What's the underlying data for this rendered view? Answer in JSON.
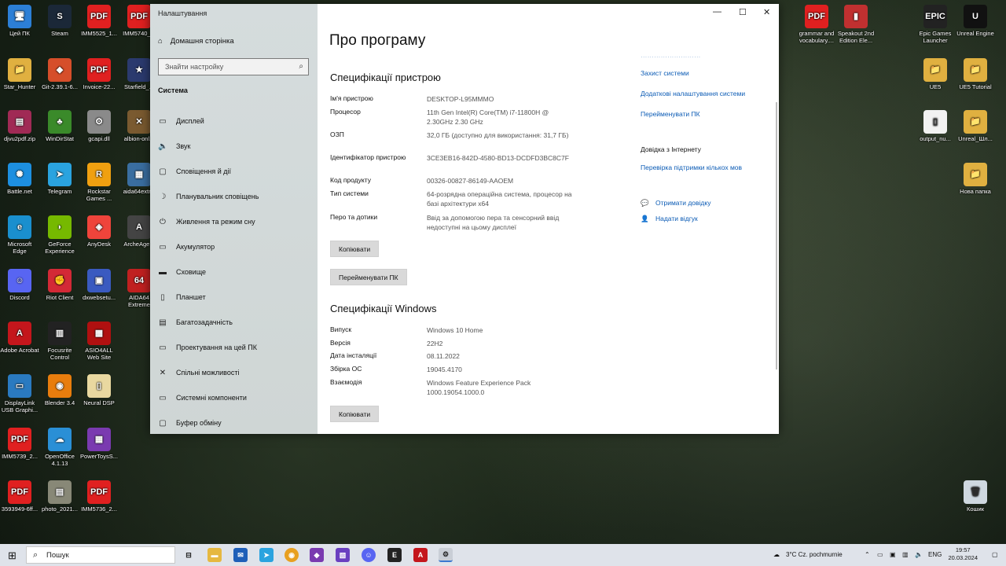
{
  "desktop": {
    "icons": [
      {
        "label": "Цей ПК",
        "glyph": "🖥",
        "color": "#2c7fd6"
      },
      {
        "label": "Steam",
        "glyph": "S",
        "color": "#1b2838"
      },
      {
        "label": "IMM5525_1...",
        "glyph": "PDF",
        "color": "#e02020"
      },
      {
        "label": "IMM5740_...",
        "glyph": "PDF",
        "color": "#e02020"
      },
      {
        "label": "Star_Hunter",
        "glyph": "📁",
        "color": "#e0b040"
      },
      {
        "label": "Git-2.39.1-6...",
        "glyph": "◆",
        "color": "#d64e2a"
      },
      {
        "label": "Invoice-22...",
        "glyph": "PDF",
        "color": "#e02020"
      },
      {
        "label": "Starfield_...",
        "glyph": "★",
        "color": "#2b3a6e"
      },
      {
        "label": "djvu2pdf.zip",
        "glyph": "▤",
        "color": "#a02a55"
      },
      {
        "label": "WinDirStat",
        "glyph": "♣",
        "color": "#3a8a2a"
      },
      {
        "label": "gcapi.dll",
        "glyph": "⚙",
        "color": "#8a8a8a"
      },
      {
        "label": "albion-onl...",
        "glyph": "✕",
        "color": "#7a5a30"
      },
      {
        "label": "Battle.net",
        "glyph": "✺",
        "color": "#1d8fe0"
      },
      {
        "label": "Telegram",
        "glyph": "➤",
        "color": "#2aa3df"
      },
      {
        "label": "Rockstar Games ...",
        "glyph": "R",
        "color": "#f0a010"
      },
      {
        "label": "aida64extr...",
        "glyph": "▦",
        "color": "#3a6ea0"
      },
      {
        "label": "Microsoft Edge",
        "glyph": "e",
        "color": "#1a8fce"
      },
      {
        "label": "GeForce Experience",
        "glyph": "◗",
        "color": "#76b900"
      },
      {
        "label": "AnyDesk",
        "glyph": "◈",
        "color": "#ef443b"
      },
      {
        "label": "ArcheAge...",
        "glyph": "A",
        "color": "#444444"
      },
      {
        "label": "Discord",
        "glyph": "☺",
        "color": "#5865f2"
      },
      {
        "label": "Riot Client",
        "glyph": "✊",
        "color": "#d32936"
      },
      {
        "label": "dxwebsetu...",
        "glyph": "▣",
        "color": "#3a5ac0"
      },
      {
        "label": "AIDA64 Extreme",
        "glyph": "64",
        "color": "#c02020"
      },
      {
        "label": "Adobe Acrobat",
        "glyph": "A",
        "color": "#c4161c"
      },
      {
        "label": "Focusrite Control",
        "glyph": "▥",
        "color": "#222222"
      },
      {
        "label": "ASIO4ALL Web Site",
        "glyph": "▩",
        "color": "#b01010"
      },
      {
        "label": "",
        "glyph": "",
        "color": "transparent"
      },
      {
        "label": "DisplayLink USB Graphi...",
        "glyph": "▭",
        "color": "#2a7ac0"
      },
      {
        "label": "Blender 3.4",
        "glyph": "◉",
        "color": "#e87d0d"
      },
      {
        "label": "Neural DSP",
        "glyph": "▯",
        "color": "#e9d8a0"
      },
      {
        "label": "",
        "glyph": "",
        "color": "transparent"
      },
      {
        "label": "IMM5739_2...",
        "glyph": "PDF",
        "color": "#e02020"
      },
      {
        "label": "OpenOffice 4.1.13",
        "glyph": "☁",
        "color": "#2a8fd6"
      },
      {
        "label": "PowerToysS...",
        "glyph": "▦",
        "color": "#7a3ab0"
      },
      {
        "label": "",
        "glyph": "",
        "color": "transparent"
      },
      {
        "label": "3593949-6ff...",
        "glyph": "PDF",
        "color": "#e02020"
      },
      {
        "label": "photo_2021...",
        "glyph": "▤",
        "color": "#888877"
      },
      {
        "label": "IMM5736_2...",
        "glyph": "PDF",
        "color": "#e02020"
      }
    ],
    "right_icons": [
      {
        "label": "grammar and vocabulary....",
        "glyph": "PDF",
        "color": "#e02020"
      },
      {
        "label": "Speakout 2nd Edition Ele...",
        "glyph": "▮",
        "color": "#c03030"
      },
      {
        "label": "Epic Games Launcher",
        "glyph": "EPIC",
        "color": "#222222"
      },
      {
        "label": "Unreal Engine",
        "glyph": "U",
        "color": "#111111"
      },
      {
        "label": "UE5",
        "glyph": "📁",
        "color": "#e0b040"
      },
      {
        "label": "UE5 Tutorial",
        "glyph": "📁",
        "color": "#e0b040"
      },
      {
        "label": "output_nu...",
        "glyph": "▯",
        "color": "#f2f2f2"
      },
      {
        "label": "Unreal_Шл...",
        "glyph": "📁",
        "color": "#e0b040"
      },
      {
        "label": "Нова папка",
        "glyph": "📁",
        "color": "#e0b040"
      },
      {
        "label": "Кошик",
        "glyph": "🗑",
        "color": "#cfd8e0"
      }
    ]
  },
  "window": {
    "title": "Налаштування",
    "home": "Домашня сторінка",
    "search_placeholder": "Знайти настройку",
    "section": "Система",
    "nav_items": [
      {
        "label": "Дисплей",
        "icon": "▭"
      },
      {
        "label": "Звук",
        "icon": "🔈"
      },
      {
        "label": "Сповіщення й дії",
        "icon": "▢"
      },
      {
        "label": "Планувальник сповіщень",
        "icon": "☽"
      },
      {
        "label": "Живлення та режим сну",
        "icon": "⏻"
      },
      {
        "label": "Акумулятор",
        "icon": "▭"
      },
      {
        "label": "Сховище",
        "icon": "▬"
      },
      {
        "label": "Планшет",
        "icon": "▯"
      },
      {
        "label": "Багатозадачність",
        "icon": "▤"
      },
      {
        "label": "Проектування на цей ПК",
        "icon": "▭"
      },
      {
        "label": "Спільні можливості",
        "icon": "✕"
      },
      {
        "label": "Системні компоненти",
        "icon": "▭"
      },
      {
        "label": "Буфер обміну",
        "icon": "▢"
      }
    ],
    "heading": "Про програму",
    "device_specs_title": "Специфікації пристрою",
    "device_specs": [
      {
        "label": "Ім'я пристрою",
        "value": "DESKTOP-L95MMMO"
      },
      {
        "label": "Процесор",
        "value": "11th Gen Intel(R) Core(TM) i7-11800H @ 2.30GHz   2.30 GHz"
      },
      {
        "label": "ОЗП",
        "value": "32,0 ГБ (доступно для використання: 31,7 ГБ)"
      },
      {
        "label": "Ідентифікатор пристрою",
        "value": "3CE3EB16-842D-4580-BD13-DCDFD3BC8C7F"
      },
      {
        "label": "Код продукту",
        "value": "00326-00827-86149-AAOEM"
      },
      {
        "label": "Тип системи",
        "value": "64-розрядна операційна система, процесор на базі архітектури x64"
      },
      {
        "label": "Перо та дотики",
        "value": "Ввід за допомогою пера та сенсорний ввід недоступні на цьому дисплеї"
      }
    ],
    "copy_button": "Копіювати",
    "rename_button": "Перейменувати ПК",
    "windows_specs_title": "Специфікації Windows",
    "windows_specs": [
      {
        "label": "Випуск",
        "value": "Windows 10 Home"
      },
      {
        "label": "Версія",
        "value": "22H2"
      },
      {
        "label": "Дата інсталяції",
        "value": "08.11.2022"
      },
      {
        "label": "Збірка ОС",
        "value": "19045.4170"
      },
      {
        "label": "Взаємодія",
        "value": "Windows Feature Experience Pack 1000.19054.1000.0"
      }
    ],
    "copy_button2": "Копіювати",
    "side_links": [
      "Захист системи",
      "Додаткові налаштування системи",
      "Перейменувати ПК"
    ],
    "help_title": "Довідка з Інтернету",
    "help_link": "Перевірка підтримки кількох мов",
    "get_help": "Отримати довідку",
    "feedback": "Надати відгук"
  },
  "taskbar": {
    "search": "Пошук",
    "weather": "3°C  Cz. pochmurnie",
    "lang": "ENG",
    "time": "19:57",
    "date": "20.03.2024"
  }
}
